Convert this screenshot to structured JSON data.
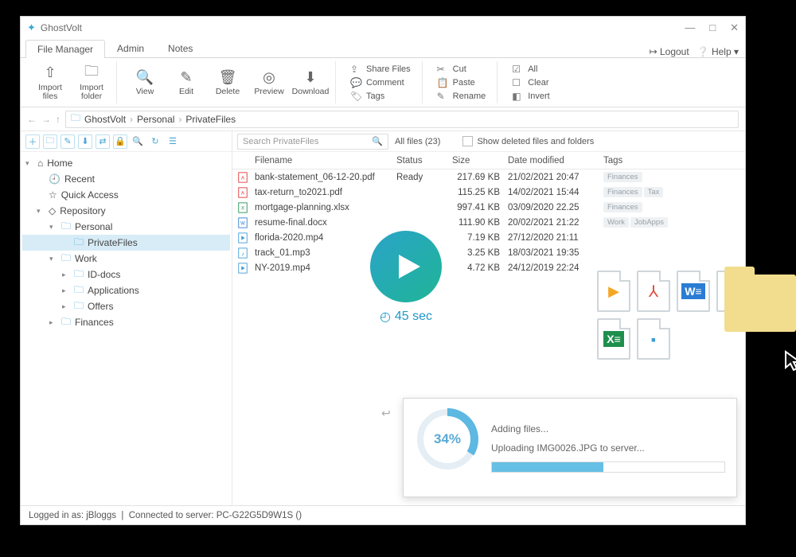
{
  "app": {
    "title": "GhostVolt"
  },
  "winControls": {
    "min": "—",
    "max": "□",
    "close": "✕"
  },
  "tabs": {
    "items": [
      "File Manager",
      "Admin",
      "Notes"
    ],
    "activeIndex": 0,
    "right": {
      "logout": "Logout",
      "help": "Help"
    }
  },
  "ribbon": {
    "group1": [
      {
        "icon": "⇧",
        "label": "Import\nfiles",
        "name": "import-files-button"
      },
      {
        "icon": "🗀",
        "label": "Import\nfolder",
        "name": "import-folder-button"
      }
    ],
    "group2": [
      {
        "icon": "🔍",
        "label": "View",
        "name": "view-button"
      },
      {
        "icon": "✎",
        "label": "Edit",
        "name": "edit-button"
      },
      {
        "icon": "🗑",
        "label": "Delete",
        "name": "delete-button"
      },
      {
        "icon": "◎",
        "label": "Preview",
        "name": "preview-button"
      },
      {
        "icon": "⬇",
        "label": "Download",
        "name": "download-button"
      }
    ],
    "group3": [
      {
        "icon": "⇪",
        "label": "Share Files",
        "name": "share-files-item"
      },
      {
        "icon": "💬",
        "label": "Comment",
        "name": "comment-item"
      },
      {
        "icon": "🏷",
        "label": "Tags",
        "name": "tags-item"
      }
    ],
    "group4": [
      {
        "icon": "✂",
        "label": "Cut",
        "name": "cut-item"
      },
      {
        "icon": "📋",
        "label": "Paste",
        "name": "paste-item"
      },
      {
        "icon": "✎",
        "label": "Rename",
        "name": "rename-item"
      }
    ],
    "group5": [
      {
        "icon": "☑",
        "label": "All",
        "name": "select-all-item"
      },
      {
        "icon": "☐",
        "label": "Clear",
        "name": "select-clear-item"
      },
      {
        "icon": "◧",
        "label": "Invert",
        "name": "select-invert-item"
      }
    ]
  },
  "breadcrumb": {
    "parts": [
      "GhostVolt",
      "Personal",
      "PrivateFiles"
    ]
  },
  "tree": {
    "home": "Home",
    "recent": "Recent",
    "quick": "Quick Access",
    "repo": "Repository",
    "personal": "Personal",
    "private": "PrivateFiles",
    "work": "Work",
    "iddocs": "ID-docs",
    "applications": "Applications",
    "offers": "Offers",
    "finances": "Finances"
  },
  "filter": {
    "searchPlaceholder": "Search PrivateFiles",
    "allFiles": "All files (23)",
    "showDeleted": "Show deleted files and folders"
  },
  "columns": {
    "name": "Filename",
    "status": "Status",
    "size": "Size",
    "date": "Date modified",
    "tags": "Tags"
  },
  "files": [
    {
      "type": "pdf",
      "name": "bank-statement_06-12-20.pdf",
      "status": "Ready",
      "size": "217.69 KB",
      "date": "21/02/2021 20:47",
      "tags": [
        "Finances"
      ]
    },
    {
      "type": "pdf",
      "name": "tax-return_to2021.pdf",
      "status": "",
      "size": "115.25 KB",
      "date": "14/02/2021 15:44",
      "tags": [
        "Finances",
        "Tax"
      ]
    },
    {
      "type": "xls",
      "name": "mortgage-planning.xlsx",
      "status": "",
      "size": "997.41 KB",
      "date": "03/09/2020 22.25",
      "tags": [
        "Finances"
      ]
    },
    {
      "type": "doc",
      "name": "resume-final.docx",
      "status": "",
      "size": "111.90 KB",
      "date": "20/02/2021 21:22",
      "tags": [
        "Work",
        "JobApps"
      ]
    },
    {
      "type": "vid",
      "name": "florida-2020.mp4",
      "status": "",
      "size": "7.19 KB",
      "date": "27/12/2020 21:11",
      "tags": []
    },
    {
      "type": "aud",
      "name": "track_01.mp3",
      "status": "",
      "size": "3.25 KB",
      "date": "18/03/2021 19:35",
      "tags": []
    },
    {
      "type": "vid",
      "name": "NY-2019.mp4",
      "status": "",
      "size": "4.72 KB",
      "date": "24/12/2019 22:24",
      "tags": []
    }
  ],
  "play": {
    "duration": "45 sec"
  },
  "upload": {
    "percent": "34%",
    "adding": "Adding files...",
    "line": "Uploading IMG0026.JPG to server...",
    "bar": 48
  },
  "status": {
    "user": "Logged in as: jBloggs",
    "sep": "  |  ",
    "server": "Connected to server: PC-G22G5D9W1S ()"
  }
}
